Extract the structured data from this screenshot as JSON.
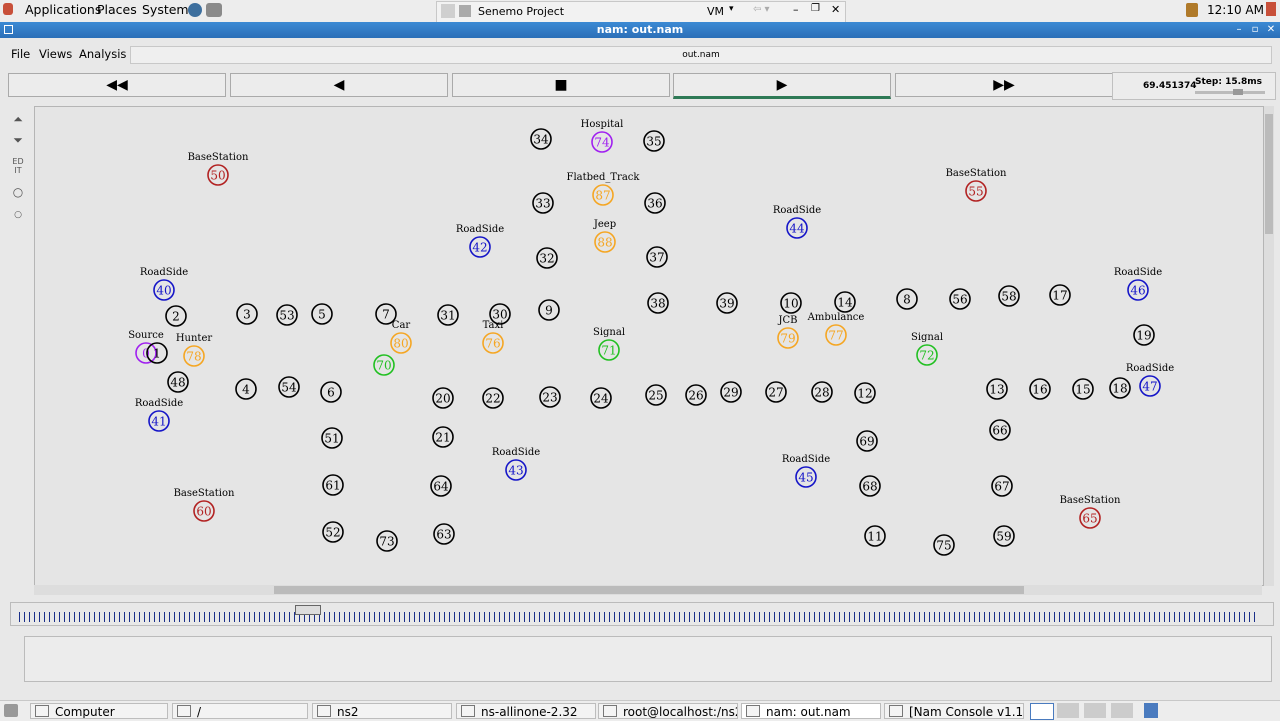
{
  "top_panel": {
    "menus": [
      "Applications",
      "Places",
      "System"
    ],
    "active_window": "Senemo Project",
    "vm_label": "VM",
    "clock": "12:10 AM"
  },
  "window": {
    "title": "nam: out.nam",
    "menus": [
      "File",
      "Views",
      "Analysis"
    ],
    "file_label": "out.nam"
  },
  "transport": {
    "time": "69.451374",
    "step": "Step: 15.8ms",
    "buttons": [
      "◀◀",
      "◀",
      "■",
      "▶",
      "▶▶"
    ]
  },
  "nodes": [
    {
      "id": "0",
      "label": "Source",
      "c": "#a020f0"
    },
    {
      "id": "1",
      "label": "",
      "c": "#000"
    },
    {
      "id": "2",
      "label": "",
      "c": "#000"
    },
    {
      "id": "3",
      "label": "",
      "c": "#000"
    },
    {
      "id": "53",
      "label": "",
      "c": "#000"
    },
    {
      "id": "5",
      "label": "",
      "c": "#000"
    },
    {
      "id": "7",
      "label": "",
      "c": "#000"
    },
    {
      "id": "31",
      "label": "",
      "c": "#000"
    },
    {
      "id": "30",
      "label": "",
      "c": "#000"
    },
    {
      "id": "9",
      "label": "",
      "c": "#000"
    },
    {
      "id": "34",
      "label": "",
      "c": "#000"
    },
    {
      "id": "74",
      "label": "Hospital",
      "c": "#a020f0"
    },
    {
      "id": "35",
      "label": "",
      "c": "#000"
    },
    {
      "id": "87",
      "label": "Flatbed_Track",
      "c": "#f5a623"
    },
    {
      "id": "33",
      "label": "",
      "c": "#000"
    },
    {
      "id": "36",
      "label": "",
      "c": "#000"
    },
    {
      "id": "88",
      "label": "Jeep",
      "c": "#f5a623"
    },
    {
      "id": "32",
      "label": "",
      "c": "#000"
    },
    {
      "id": "37",
      "label": "",
      "c": "#000"
    },
    {
      "id": "42",
      "label": "RoadSide",
      "c": "#1515c8"
    },
    {
      "id": "50",
      "label": "BaseStation",
      "c": "#b22222"
    },
    {
      "id": "40",
      "label": "RoadSide",
      "c": "#1515c8"
    },
    {
      "id": "78",
      "label": "Hunter",
      "c": "#f5a623"
    },
    {
      "id": "48",
      "label": "",
      "c": "#000"
    },
    {
      "id": "41",
      "label": "RoadSide",
      "c": "#1515c8"
    },
    {
      "id": "4",
      "label": "",
      "c": "#000"
    },
    {
      "id": "54",
      "label": "",
      "c": "#000"
    },
    {
      "id": "6",
      "label": "",
      "c": "#000"
    },
    {
      "id": "70",
      "label": "",
      "c": "#22c022"
    },
    {
      "id": "80",
      "label": "Car",
      "c": "#f5a623"
    },
    {
      "id": "76",
      "label": "Taxi",
      "c": "#f5a623"
    },
    {
      "id": "71",
      "label": "Signal",
      "c": "#22c022"
    },
    {
      "id": "38",
      "label": "",
      "c": "#000"
    },
    {
      "id": "39",
      "label": "",
      "c": "#000"
    },
    {
      "id": "10",
      "label": "",
      "c": "#000"
    },
    {
      "id": "79",
      "label": "JCB",
      "c": "#f5a623"
    },
    {
      "id": "14",
      "label": "",
      "c": "#000"
    },
    {
      "id": "77",
      "label": "Ambulance",
      "c": "#f5a623"
    },
    {
      "id": "8",
      "label": "",
      "c": "#000"
    },
    {
      "id": "56",
      "label": "",
      "c": "#000"
    },
    {
      "id": "58",
      "label": "",
      "c": "#000"
    },
    {
      "id": "17",
      "label": "",
      "c": "#000"
    },
    {
      "id": "46",
      "label": "RoadSide",
      "c": "#1515c8"
    },
    {
      "id": "19",
      "label": "",
      "c": "#000"
    },
    {
      "id": "72",
      "label": "Signal",
      "c": "#22c022"
    },
    {
      "id": "44",
      "label": "RoadSide",
      "c": "#1515c8"
    },
    {
      "id": "55",
      "label": "BaseStation",
      "c": "#b22222"
    },
    {
      "id": "20",
      "label": "",
      "c": "#000"
    },
    {
      "id": "22",
      "label": "",
      "c": "#000"
    },
    {
      "id": "23",
      "label": "",
      "c": "#000"
    },
    {
      "id": "24",
      "label": "",
      "c": "#000"
    },
    {
      "id": "25",
      "label": "",
      "c": "#000"
    },
    {
      "id": "26",
      "label": "",
      "c": "#000"
    },
    {
      "id": "29",
      "label": "",
      "c": "#000"
    },
    {
      "id": "27",
      "label": "",
      "c": "#000"
    },
    {
      "id": "28",
      "label": "",
      "c": "#000"
    },
    {
      "id": "12",
      "label": "",
      "c": "#000"
    },
    {
      "id": "13",
      "label": "",
      "c": "#000"
    },
    {
      "id": "16",
      "label": "",
      "c": "#000"
    },
    {
      "id": "15",
      "label": "",
      "c": "#000"
    },
    {
      "id": "18",
      "label": "",
      "c": "#000"
    },
    {
      "id": "47",
      "label": "RoadSide",
      "c": "#1515c8"
    },
    {
      "id": "51",
      "label": "",
      "c": "#000"
    },
    {
      "id": "21",
      "label": "",
      "c": "#000"
    },
    {
      "id": "43",
      "label": "RoadSide",
      "c": "#1515c8"
    },
    {
      "id": "69",
      "label": "",
      "c": "#000"
    },
    {
      "id": "66",
      "label": "",
      "c": "#000"
    },
    {
      "id": "61",
      "label": "",
      "c": "#000"
    },
    {
      "id": "64",
      "label": "",
      "c": "#000"
    },
    {
      "id": "45",
      "label": "RoadSide",
      "c": "#1515c8"
    },
    {
      "id": "68",
      "label": "",
      "c": "#000"
    },
    {
      "id": "67",
      "label": "",
      "c": "#000"
    },
    {
      "id": "60",
      "label": "BaseStation",
      "c": "#b22222"
    },
    {
      "id": "65",
      "label": "BaseStation",
      "c": "#b22222"
    },
    {
      "id": "52",
      "label": "",
      "c": "#000"
    },
    {
      "id": "73",
      "label": "",
      "c": "#000"
    },
    {
      "id": "63",
      "label": "",
      "c": "#000"
    },
    {
      "id": "11",
      "label": "",
      "c": "#000"
    },
    {
      "id": "75",
      "label": "",
      "c": "#000"
    },
    {
      "id": "59",
      "label": "",
      "c": "#000"
    }
  ],
  "taskbar": [
    {
      "label": "Computer"
    },
    {
      "label": "/"
    },
    {
      "label": "ns2"
    },
    {
      "label": "ns-allinone-2.32"
    },
    {
      "label": "root@localhost:/ns2..."
    },
    {
      "label": "nam: out.nam"
    },
    {
      "label": "[Nam Console v1.13]"
    }
  ]
}
